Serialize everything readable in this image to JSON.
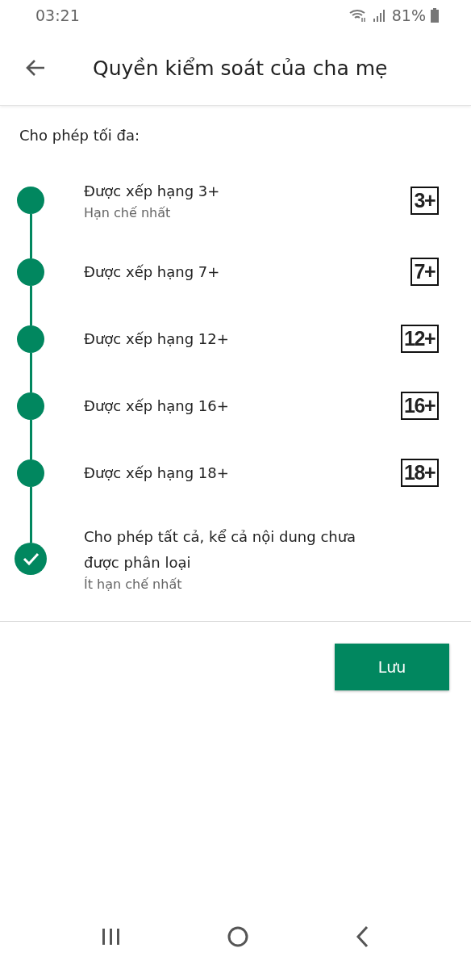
{
  "status_bar": {
    "time": "03:21",
    "battery": "81%"
  },
  "header": {
    "title": "Quyền kiểm soát của cha mẹ"
  },
  "section_label": "Cho phép tối đa:",
  "ratings": [
    {
      "label": "Được xếp hạng 3+",
      "sublabel": "Hạn chế nhất",
      "badge": "3+",
      "selected": false
    },
    {
      "label": "Được xếp hạng 7+",
      "badge": "7+",
      "selected": false
    },
    {
      "label": "Được xếp hạng 12+",
      "badge": "12+",
      "selected": false
    },
    {
      "label": "Được xếp hạng 16+",
      "badge": "16+",
      "selected": false
    },
    {
      "label": "Được xếp hạng 18+",
      "badge": "18+",
      "selected": false
    },
    {
      "label": "Cho phép tất cả, kể cả nội dung chưa được phân loại",
      "sublabel": "Ít hạn chế nhất",
      "selected": true
    }
  ],
  "save_button": "Lưu"
}
